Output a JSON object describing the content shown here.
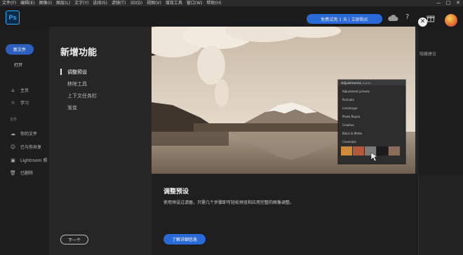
{
  "menu": [
    "文件(F)",
    "编辑(E)",
    "图像(I)",
    "图层(L)",
    "文字(Y)",
    "选择(S)",
    "滤镜(T)",
    "3D(D)",
    "视图(V)",
    "增效工具",
    "窗口(W)",
    "帮助(H)"
  ],
  "window_controls": [
    "—",
    "□",
    "✕"
  ],
  "app": {
    "logo": "Ps",
    "trial_button": "免费试用 1 天 | 立即购买"
  },
  "sidebar": {
    "new_file": "新文件",
    "open": "打开",
    "nav": [
      {
        "label": "主页",
        "icon": "home-icon",
        "glyph": "⌂"
      },
      {
        "label": "学习",
        "icon": "bulb-icon",
        "glyph": "☼"
      }
    ],
    "files_section": "文件",
    "files": [
      {
        "label": "你的文件",
        "icon": "cloud-doc-icon",
        "glyph": "☁"
      },
      {
        "label": "已与你共享",
        "icon": "people-icon",
        "glyph": "☺"
      },
      {
        "label": "Lightroom 照",
        "icon": "lightroom-icon",
        "glyph": "▣"
      },
      {
        "label": "已删除",
        "icon": "trash-icon",
        "glyph": "🗑"
      }
    ]
  },
  "background": {
    "hide_suggestions": "隐藏建议"
  },
  "modal": {
    "title": "新增功能",
    "nav": [
      "调整预设",
      "移除工具",
      "上下文任务栏",
      "渐变"
    ],
    "active_index": 0,
    "next": "下一个",
    "close": "✕",
    "hero_panel": {
      "tabs": [
        "Adjustments",
        "Layers"
      ],
      "rows": [
        "Adjustment presets",
        "Portraits",
        "Landscape",
        "Photo Repair",
        "Creative",
        "Black & White",
        "Cinematic"
      ]
    },
    "detail_title": "调整预设",
    "detail_body": "使用预设过滤器，只需几个步骤即可轻松预览和应用完整的图像调整。",
    "learn_more": "了解详细信息"
  },
  "colors": {
    "accent": "#2a6ad8",
    "ps_blue": "#31a8ff"
  }
}
